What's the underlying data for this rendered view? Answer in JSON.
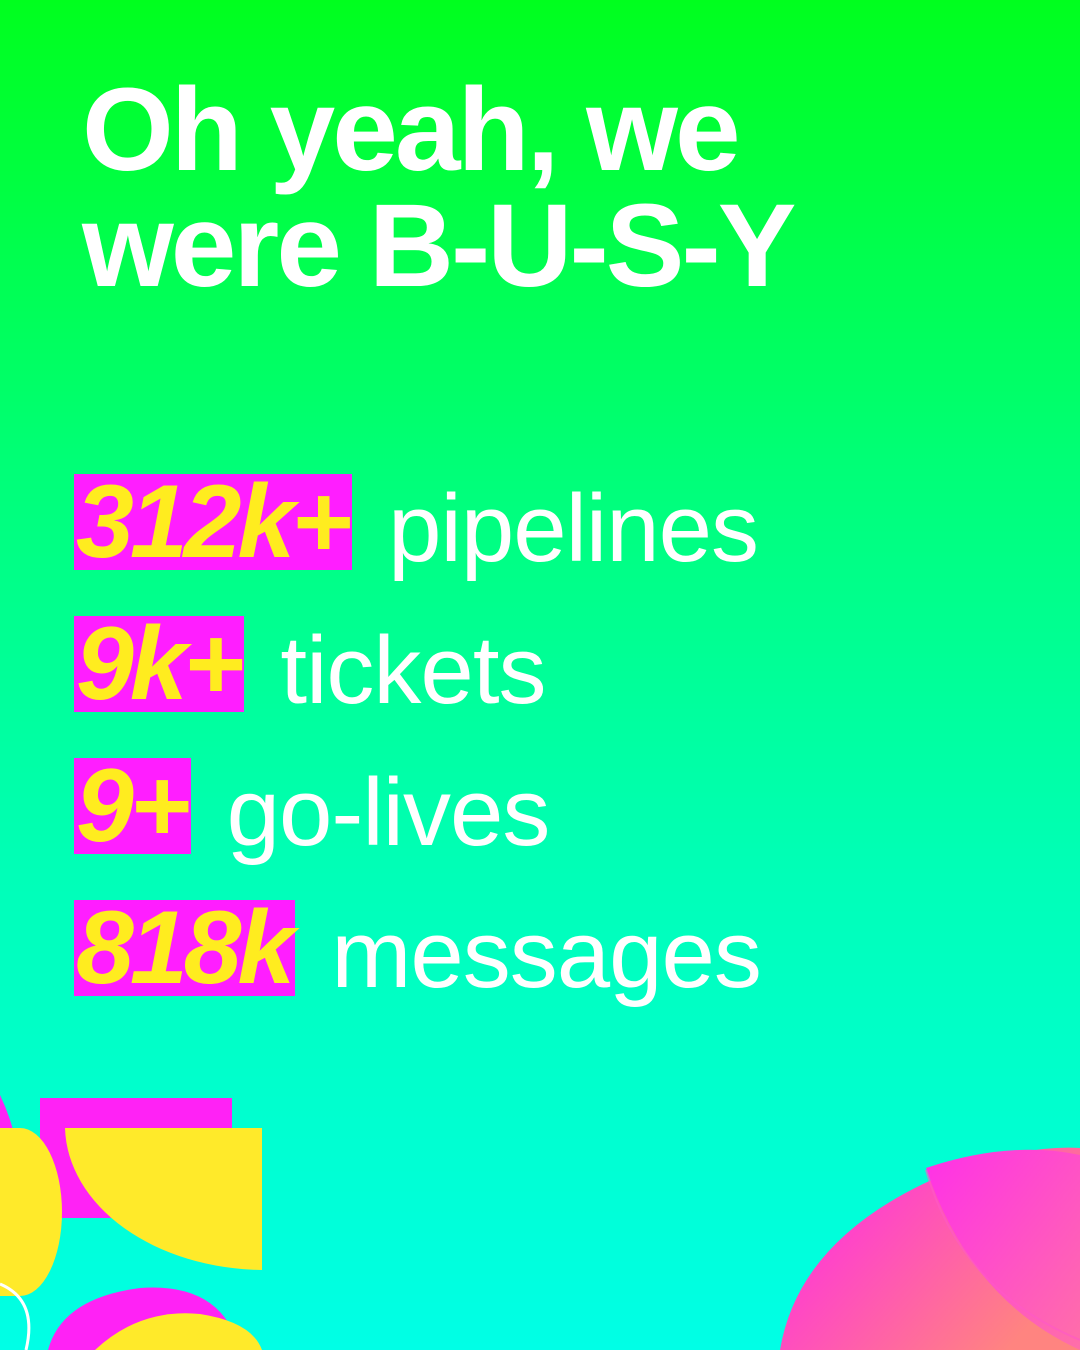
{
  "headline": {
    "line1": "Oh yeah, we",
    "line2": "were B-U-S-Y"
  },
  "stats": [
    {
      "value": "312k+",
      "label": "pipelines"
    },
    {
      "value": "9k+",
      "label": "tickets"
    },
    {
      "value": "9+",
      "label": "go-lives"
    },
    {
      "value": "818k",
      "label": "messages"
    }
  ],
  "colors": {
    "background_top": "#00FF1E",
    "background_bottom": "#00FFE6",
    "highlight": "#FF1EFF",
    "number_text": "#FFEC1F",
    "text": "#FFFFFF",
    "accent_pink": "#FF2BE0",
    "accent_coral": "#FF7A8A"
  }
}
